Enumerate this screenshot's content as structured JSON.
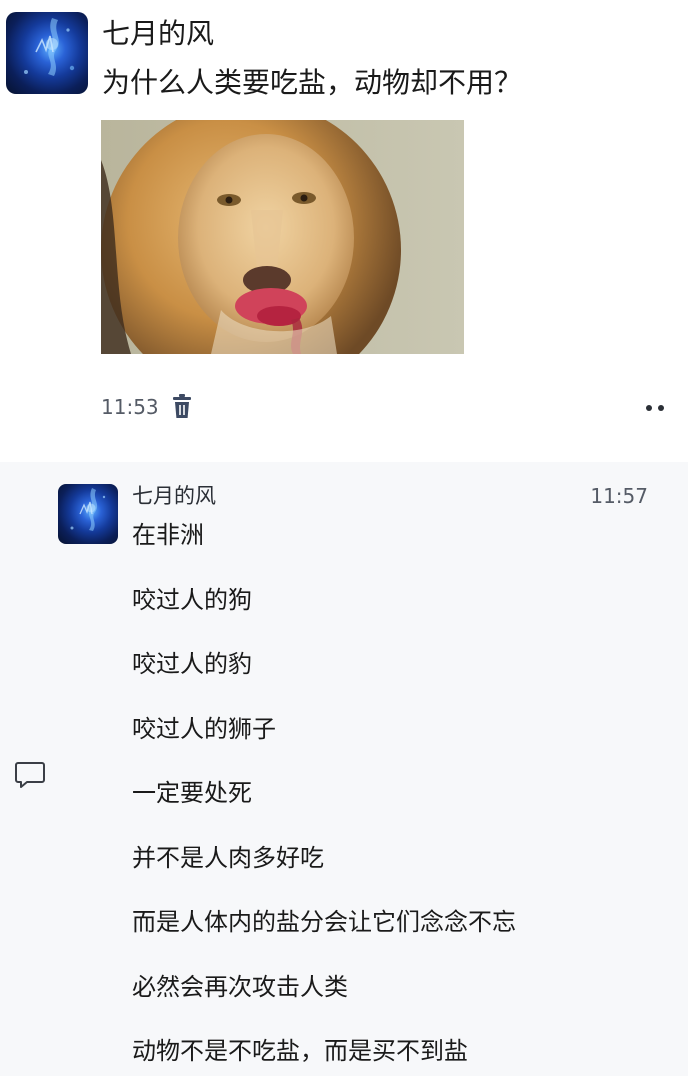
{
  "post": {
    "author": "七月的风",
    "title": "为什么人类要吃盐，动物却不用？",
    "image_icon": "lion-photo",
    "time": "11:53",
    "delete_icon": "trash-icon",
    "more_icon": "more-dots-icon"
  },
  "comment": {
    "author": "七月的风",
    "time": "11:57",
    "reply_icon": "comment-bubble-icon",
    "lines": [
      "在非洲",
      "咬过人的狗",
      "咬过人的豹",
      "咬过人的狮子",
      "一定要处死",
      "并不是人肉多好吃",
      "而是人体内的盐分会让它们念念不忘",
      "必然会再次攻击人类",
      "动物不是不吃盐，而是买不到盐"
    ]
  },
  "colors": {
    "background": "#ffffff",
    "comment_background": "#f7f8fa",
    "text": "#1a1a1a",
    "meta_text": "#555b66",
    "trash_icon": "#3d4a63"
  }
}
